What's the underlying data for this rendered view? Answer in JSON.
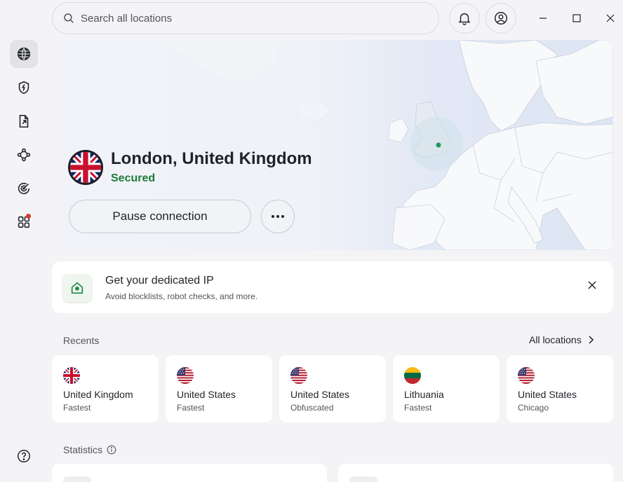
{
  "search": {
    "placeholder": "Search all locations"
  },
  "rail": {
    "items": [
      {
        "icon": "globe-icon",
        "active": true
      },
      {
        "icon": "shield-bolt-icon"
      },
      {
        "icon": "file-share-icon"
      },
      {
        "icon": "mesh-network-icon"
      },
      {
        "icon": "radar-icon"
      },
      {
        "icon": "apps-grid-icon",
        "badge": true
      }
    ],
    "help_icon": "help-icon"
  },
  "header": {
    "icons": [
      "bell-icon",
      "account-icon"
    ],
    "window_controls": [
      "minimize-icon",
      "maximize-icon",
      "close-icon"
    ]
  },
  "connection": {
    "location": "London, United Kingdom",
    "status": "Secured",
    "pause_label": "Pause connection",
    "more_icon": "more-dots-icon",
    "status_color": "#1d7a3a"
  },
  "promo": {
    "title": "Get your dedicated IP",
    "subtitle": "Avoid blocklists, robot checks, and more.",
    "icon": "home-pin-icon"
  },
  "recents": {
    "label": "Recents",
    "all_locations": "All locations",
    "items": [
      {
        "country": "United Kingdom",
        "detail": "Fastest",
        "flag": "uk-flag"
      },
      {
        "country": "United States",
        "detail": "Fastest",
        "flag": "us-flag"
      },
      {
        "country": "United States",
        "detail": "Obfuscated",
        "flag": "us-flag"
      },
      {
        "country": "Lithuania",
        "detail": "Fastest",
        "flag": "lt-flag"
      },
      {
        "country": "United States",
        "detail": "Chicago",
        "flag": "us-flag"
      }
    ]
  },
  "statistics": {
    "label": "Statistics"
  }
}
